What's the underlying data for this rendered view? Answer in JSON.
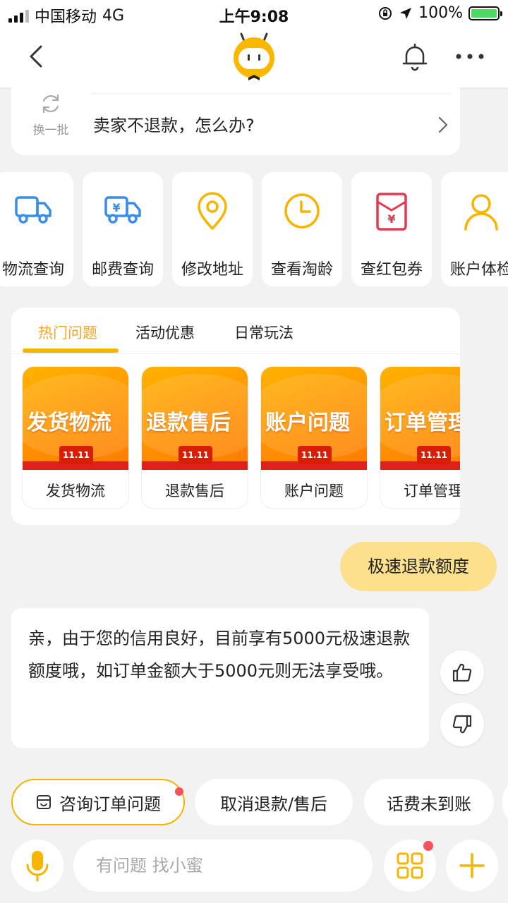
{
  "status_bar": {
    "carrier": "中国移动",
    "network": "4G",
    "time": "上午9:08",
    "battery": "100%"
  },
  "navbar": {
    "back_icon": "chevron-left-icon",
    "mascot_icon": "mascot-icon",
    "bell_icon": "bell-icon",
    "more_icon": "more-dots-icon"
  },
  "suggest": {
    "refresh_label": "换一批",
    "question": "卖家不退款，怎么办?"
  },
  "services": [
    {
      "label": "物流查询",
      "icon": "truck-icon",
      "color": "#3a8ee6"
    },
    {
      "label": "邮费查询",
      "icon": "postage-truck-icon",
      "color": "#3a8ee6"
    },
    {
      "label": "修改地址",
      "icon": "location-pin-icon",
      "color": "#f7b500"
    },
    {
      "label": "查看淘龄",
      "icon": "clock-icon",
      "color": "#f7b500"
    },
    {
      "label": "查红包券",
      "icon": "red-envelope-icon",
      "color": "#e8384f"
    },
    {
      "label": "账户体检",
      "icon": "user-icon",
      "color": "#f7b500"
    }
  ],
  "hot": {
    "tabs": [
      "热门问题",
      "活动优惠",
      "日常玩法"
    ],
    "active_tab": 0,
    "topics": [
      {
        "banner": "发货物流",
        "label": "发货物流",
        "tag": "11.11"
      },
      {
        "banner": "退款售后",
        "label": "退款售后",
        "tag": "11.11"
      },
      {
        "banner": "账户问题",
        "label": "账户问题",
        "tag": "11.11"
      },
      {
        "banner": "订单管理",
        "label": "订单管理",
        "tag": "11.11"
      }
    ]
  },
  "chat": {
    "user_message": "极速退款额度",
    "reply": "亲，由于您的信用良好，目前享有5000元极速退款额度哦，如订单金额大于5000元则无法享受哦。"
  },
  "chips": [
    {
      "label": "咨询订单问题",
      "icon": "order-icon",
      "active": true
    },
    {
      "label": "取消退款/售后",
      "active": false
    },
    {
      "label": "话费未到账",
      "active": false
    }
  ],
  "input": {
    "placeholder": "有问题 找小蜜"
  },
  "colors": {
    "accent": "#f7b500",
    "blue": "#3a8ee6",
    "red": "#e8384f",
    "bubble": "#fde08b"
  }
}
